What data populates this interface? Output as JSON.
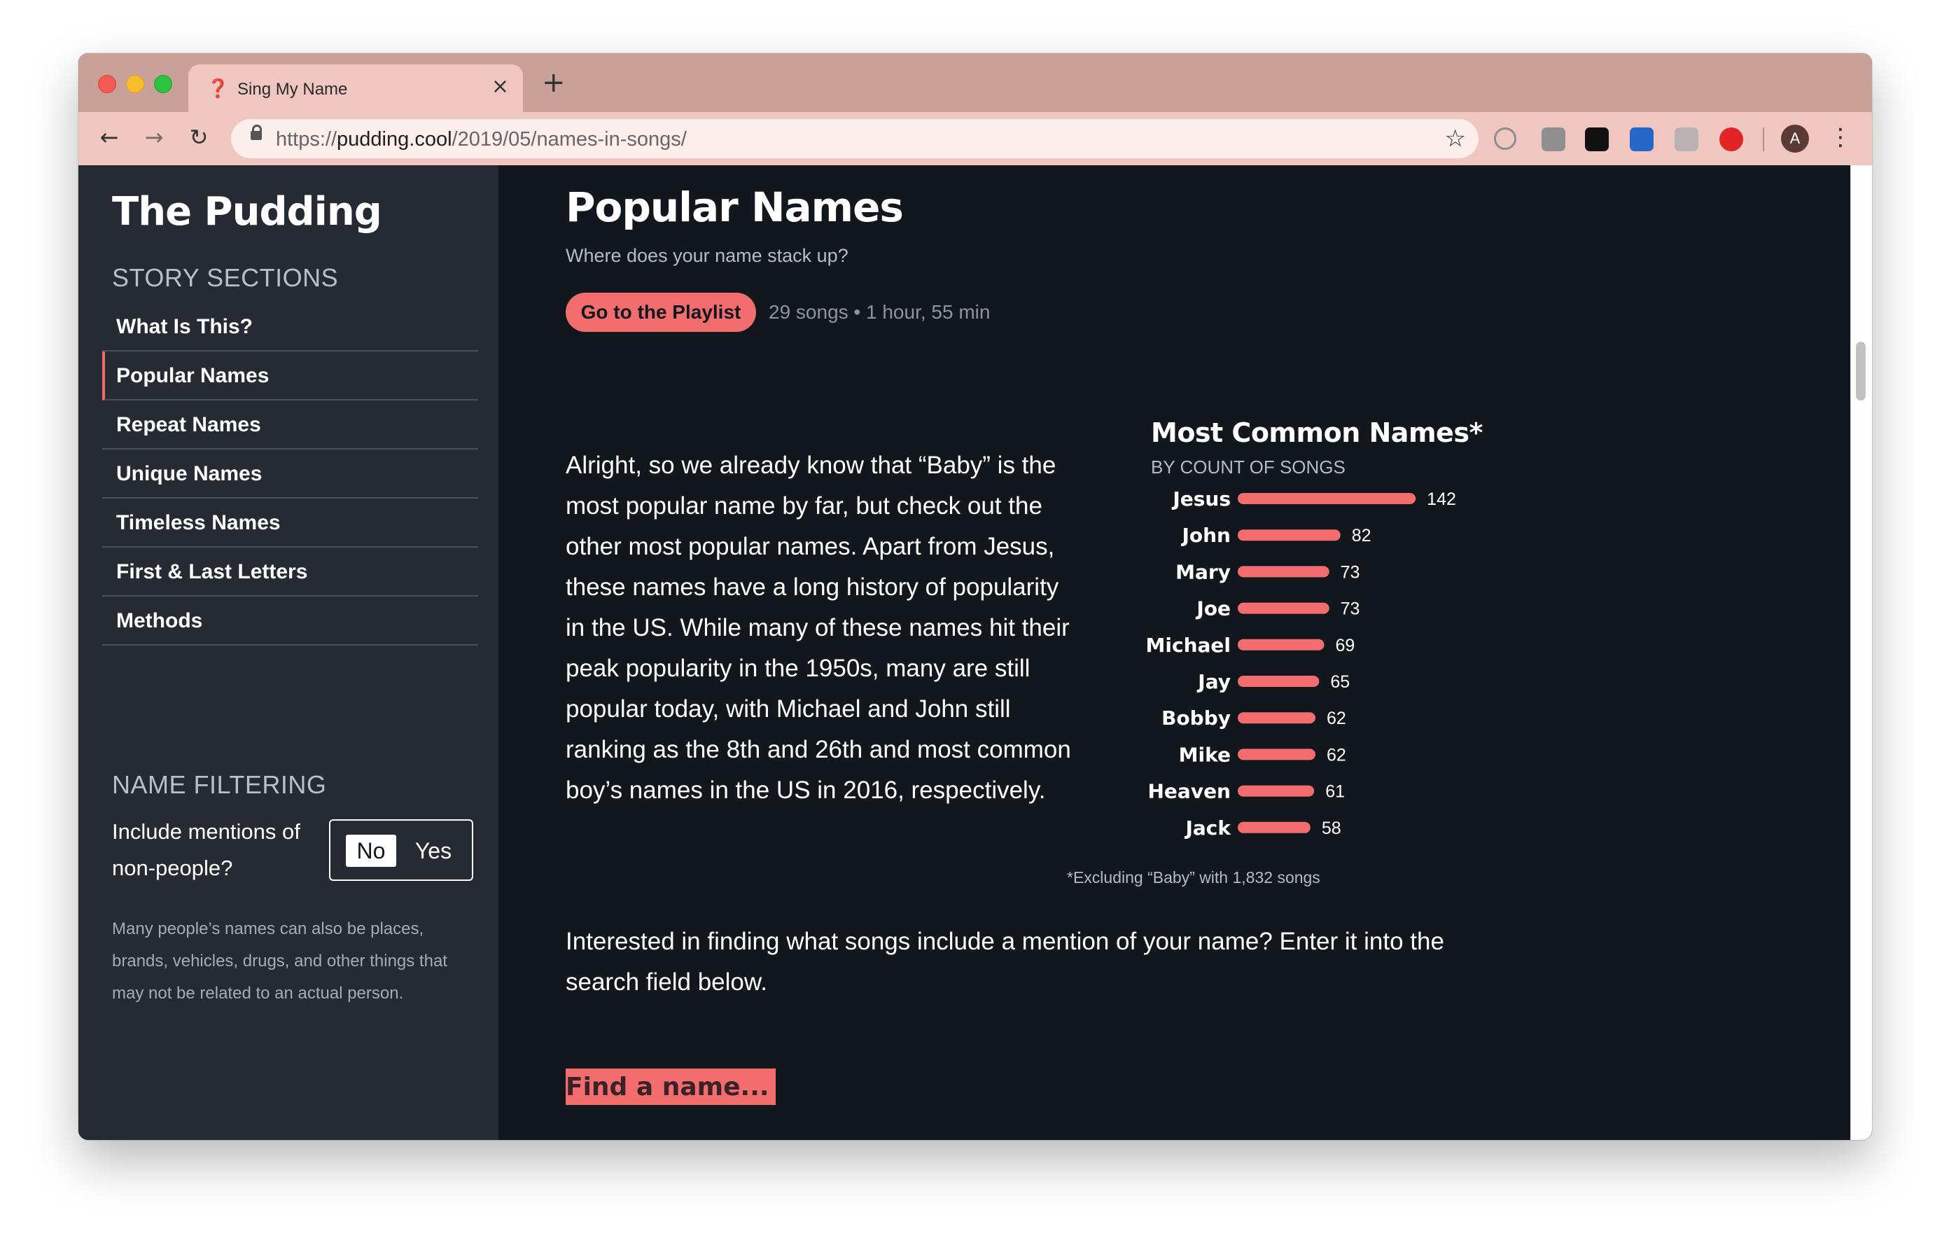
{
  "browser": {
    "tab_title": "Sing My Name",
    "tab_favicon": "❓",
    "new_tab_symbol": "+",
    "url_prefix": "https://",
    "url_domain": "pudding.cool",
    "url_path": "/2019/05/names-in-songs/",
    "profile_initial": "A",
    "icons": {
      "back": "back-arrow-icon",
      "forward": "forward-arrow-icon",
      "reload": "reload-icon",
      "lock": "lock-icon",
      "bookmark": "star-icon",
      "menu": "kebab-menu-icon"
    }
  },
  "sidebar": {
    "logo": "The Pudding",
    "sections_heading": "STORY SECTIONS",
    "items": [
      {
        "label": "What Is This?"
      },
      {
        "label": "Popular Names",
        "active": true
      },
      {
        "label": "Repeat Names"
      },
      {
        "label": "Unique Names"
      },
      {
        "label": "Timeless Names"
      },
      {
        "label": "First & Last Letters"
      },
      {
        "label": "Methods"
      }
    ],
    "filter_heading": "NAME FILTERING",
    "filter_question": "Include mentions of non-people?",
    "toggle_no": "No",
    "toggle_yes": "Yes",
    "toggle_selected": "No",
    "filter_note": "Many people’s names can also be places, brands, vehicles, drugs, and other things that may not be related to an actual person."
  },
  "main": {
    "title": "Popular Names",
    "subtitle": "Where does your name stack up?",
    "playlist_button": "Go to the Playlist",
    "playlist_meta": "29 songs • 1 hour, 55 min",
    "paragraph1": "Alright, so we already know that “Baby” is the most popular name by far, but check out the other most popular names. Apart from Jesus, these names have a long history of popularity in the US. While many of these names hit their peak popularity in the 1950s, many are still popular today, with Michael and John still ranking as the 8th and 26th and most common boy’s names in the US in 2016, respectively.",
    "paragraph2": "Interested in finding what songs include a mention of your name? Enter it into the search field below.",
    "search_placeholder": "Find a name..."
  },
  "colors": {
    "accent": "#f36c6e",
    "page_bg": "#12161d",
    "sidebar_bg": "#252a33",
    "chrome": "#efc7c0"
  },
  "chart_data": {
    "type": "bar",
    "orientation": "horizontal",
    "title": "Most Common Names*",
    "subtitle": "BY COUNT OF SONGS",
    "categories": [
      "Jesus",
      "John",
      "Mary",
      "Joe",
      "Michael",
      "Jay",
      "Bobby",
      "Mike",
      "Heaven",
      "Jack"
    ],
    "values": [
      142,
      82,
      73,
      73,
      69,
      65,
      62,
      62,
      61,
      58
    ],
    "footnote": "*Excluding “Baby” with 1,832 songs",
    "grid": false,
    "data_labels": true
  }
}
